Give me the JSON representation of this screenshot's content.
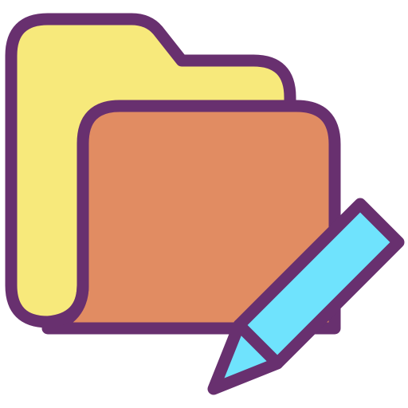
{
  "icon": {
    "name": "edit-folder-icon",
    "parts": [
      "folder-back-icon",
      "folder-front-icon",
      "pencil-icon"
    ]
  },
  "colors": {
    "outline": "#68306F",
    "folder_back": "#F7E97B",
    "folder_front": "#E18C62",
    "pencil_body": "#6FE3FD",
    "pencil_tip": "#6FE3FD",
    "background": "#FFFFFF"
  }
}
